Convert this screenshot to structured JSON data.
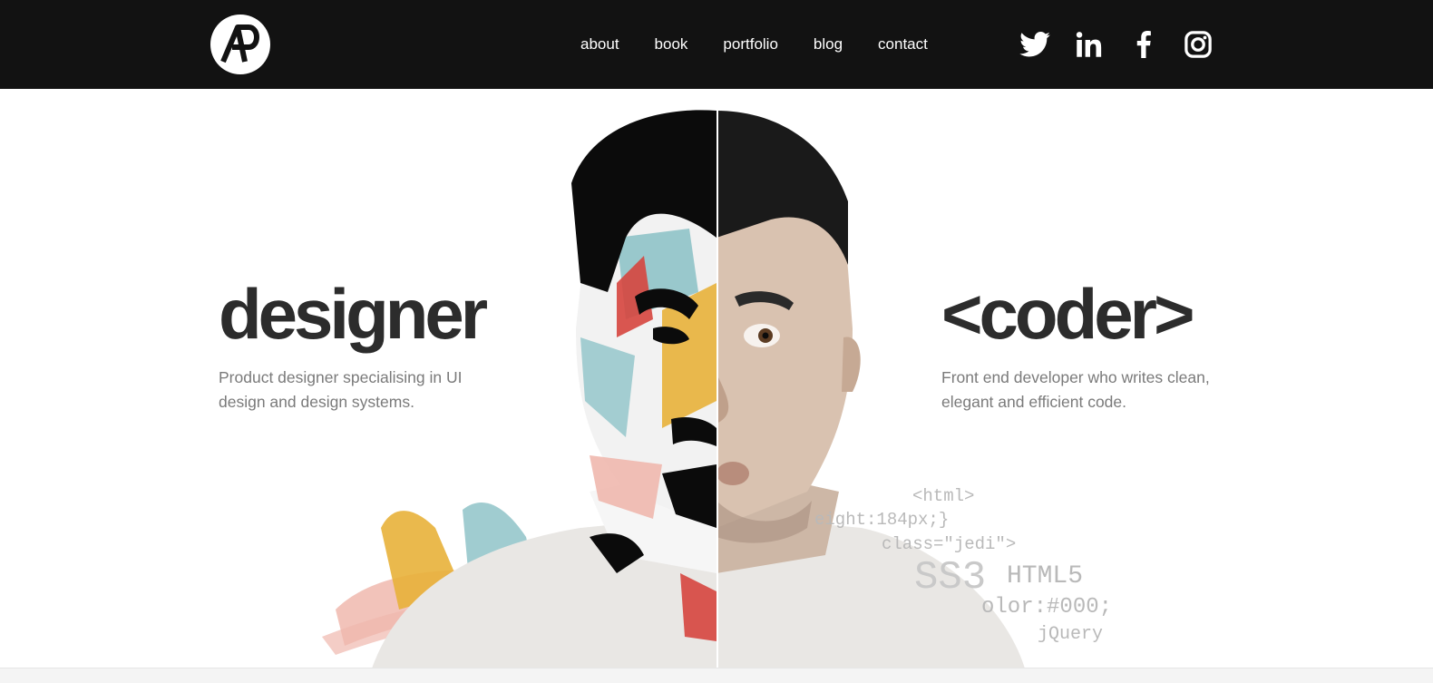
{
  "nav": {
    "items": [
      "about",
      "book",
      "portfolio",
      "blog",
      "contact"
    ]
  },
  "social": {
    "icons": [
      "twitter-icon",
      "linkedin-icon",
      "facebook-icon",
      "instagram-icon"
    ]
  },
  "hero": {
    "left": {
      "title": "designer",
      "description": "Product designer specialising in UI design and design systems."
    },
    "right": {
      "title": "<coder>",
      "description": "Front end developer who writes clean, elegant and efficient code."
    }
  },
  "code_snippets": {
    "html_tag": "<html>",
    "height_rule": "eight:184px;}",
    "class_attr": "class=\"jedi\">",
    "css3": "SS3",
    "html5": "HTML5",
    "color_rule": "olor:#000;",
    "jquery": "jQuery"
  },
  "colors": {
    "header_bg": "#121212",
    "heading": "#2c2c2c",
    "body_text": "#7a7a7a",
    "splash_red": "#d6453e",
    "splash_teal": "#8fc3c8",
    "splash_yellow": "#e8b13a",
    "splash_pink": "#f0b8ae"
  }
}
